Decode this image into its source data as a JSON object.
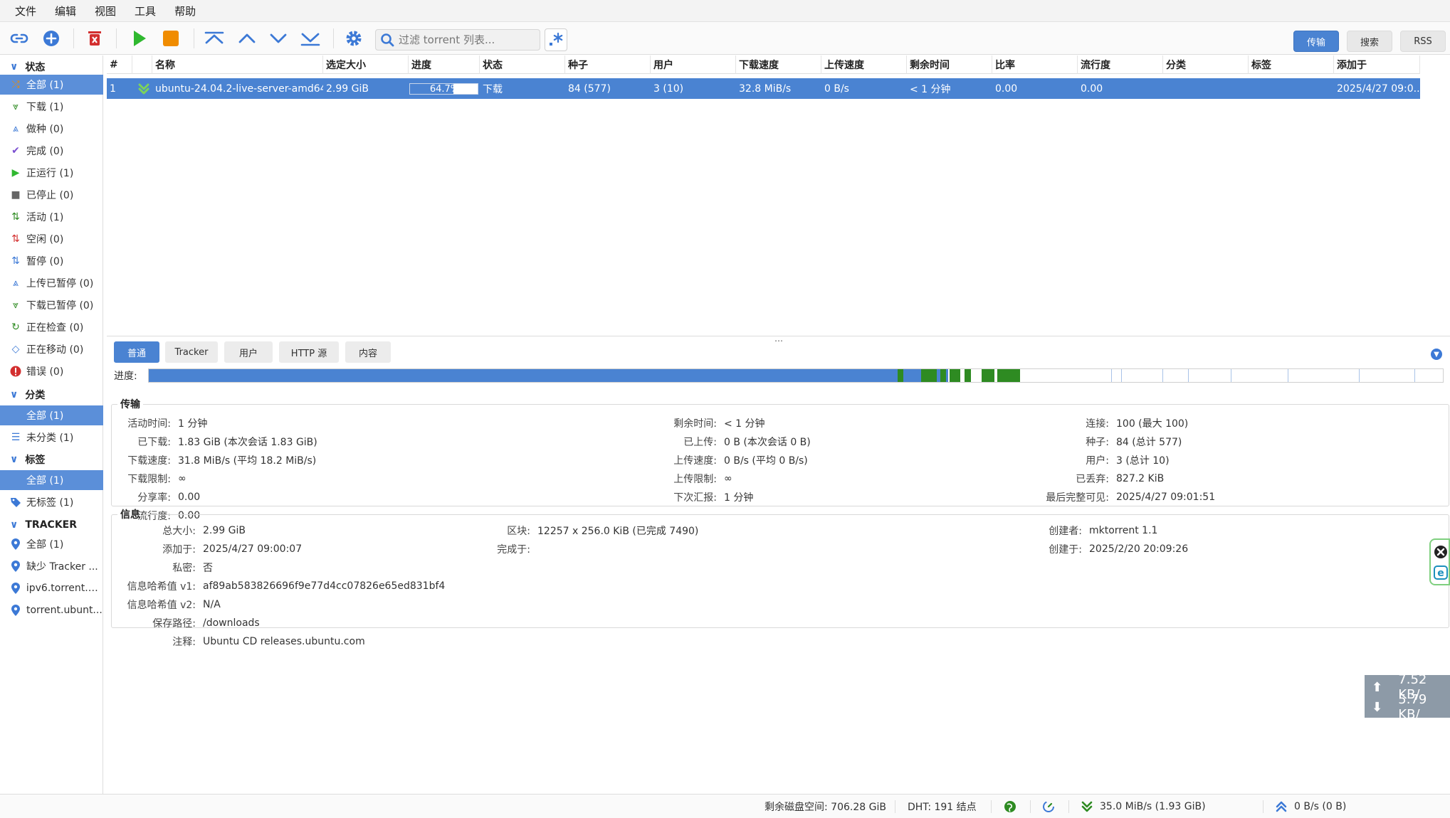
{
  "menu": [
    "文件",
    "编辑",
    "视图",
    "工具",
    "帮助"
  ],
  "toolbar": {
    "filter_placeholder": "过滤 torrent 列表...",
    "view_tabs": [
      "传输",
      "搜索",
      "RSS"
    ]
  },
  "sidebar": {
    "status_header": "状态",
    "status_items": [
      {
        "label": "全部 (1)",
        "icon": "shuffle-icon"
      },
      {
        "label": "下载 (1)",
        "icon": "download-arrows-icon"
      },
      {
        "label": "做种 (0)",
        "icon": "upload-arrows-icon"
      },
      {
        "label": "完成 (0)",
        "icon": "check-icon"
      },
      {
        "label": "正运行 (1)",
        "icon": "play-icon"
      },
      {
        "label": "已停止 (0)",
        "icon": "stop-icon"
      },
      {
        "label": "活动 (1)",
        "icon": "updown-active-icon"
      },
      {
        "label": "空闲 (0)",
        "icon": "updown-idle-icon"
      },
      {
        "label": "暂停 (0)",
        "icon": "updown-paused-icon"
      },
      {
        "label": "上传已暂停 (0)",
        "icon": "upload-paused-icon"
      },
      {
        "label": "下载已暂停 (0)",
        "icon": "download-paused-icon"
      },
      {
        "label": "正在检查 (0)",
        "icon": "refresh-icon"
      },
      {
        "label": "正在移动 (0)",
        "icon": "move-icon"
      },
      {
        "label": "错误 (0)",
        "icon": "error-icon"
      }
    ],
    "category_header": "分类",
    "category_items": [
      {
        "label": "全部 (1)",
        "icon": ""
      },
      {
        "label": "未分类 (1)",
        "icon": "list-icon"
      }
    ],
    "tag_header": "标签",
    "tag_items": [
      {
        "label": "全部 (1)",
        "icon": ""
      },
      {
        "label": "无标签 (1)",
        "icon": "tag-icon"
      }
    ],
    "tracker_header": "TRACKER",
    "tracker_items": [
      {
        "label": "全部 (1)",
        "icon": "pin-icon"
      },
      {
        "label": "缺少 Tracker ...",
        "icon": "pin-icon"
      },
      {
        "label": "ipv6.torrent.u...",
        "icon": "pin-icon"
      },
      {
        "label": "torrent.ubunt...",
        "icon": "pin-icon"
      }
    ]
  },
  "table": {
    "headers": [
      "#",
      "",
      "名称",
      "选定大小",
      "进度",
      "状态",
      "种子",
      "用户",
      "下载速度",
      "上传速度",
      "剩余时间",
      "比率",
      "流行度",
      "分类",
      "标签",
      "添加于"
    ],
    "rows": [
      {
        "num": "1",
        "name": "ubuntu-24.04.2-live-server-amd64...",
        "size": "2.99 GiB",
        "progress": 64.7,
        "progress_text": "64.7%",
        "state": "下载",
        "seeds": "84 (577)",
        "peers": "3 (10)",
        "dl_speed": "32.8 MiB/s",
        "ul_speed": "0 B/s",
        "eta": "< 1 分钟",
        "ratio": "0.00",
        "popularity": "0.00",
        "category": "",
        "tags": "",
        "added": "2025/4/27 09:0..."
      }
    ]
  },
  "props": {
    "tabs": [
      "普通",
      "Tracker",
      "用户",
      "HTTP 源",
      "内容"
    ],
    "progress_label": "进度:",
    "transfer_title": "传输",
    "transfer": {
      "col1": [
        {
          "k": "活动时间:",
          "v": "1 分钟"
        },
        {
          "k": "已下载:",
          "v": "1.83 GiB (本次会话 1.83 GiB)"
        },
        {
          "k": "下载速度:",
          "v": "31.8 MiB/s (平均 18.2 MiB/s)"
        },
        {
          "k": "下载限制:",
          "v": "∞"
        },
        {
          "k": "分享率:",
          "v": "0.00"
        },
        {
          "k": "流行度:",
          "v": "0.00"
        }
      ],
      "col2": [
        {
          "k": "剩余时间:",
          "v": "< 1 分钟"
        },
        {
          "k": "已上传:",
          "v": "0 B (本次会话 0 B)"
        },
        {
          "k": "上传速度:",
          "v": "0 B/s (平均 0 B/s)"
        },
        {
          "k": "上传限制:",
          "v": "∞"
        },
        {
          "k": "下次汇报:",
          "v": "1 分钟"
        }
      ],
      "col3": [
        {
          "k": "连接:",
          "v": "100 (最大 100)"
        },
        {
          "k": "种子:",
          "v": "84 (总计 577)"
        },
        {
          "k": "用户:",
          "v": "3 (总计 10)"
        },
        {
          "k": "已丢弃:",
          "v": "827.2 KiB"
        },
        {
          "k": "最后完整可见:",
          "v": "2025/4/27 09:01:51"
        }
      ]
    },
    "info_title": "信息",
    "info": {
      "col1": [
        {
          "k": "总大小:",
          "v": "2.99 GiB"
        },
        {
          "k": "添加于:",
          "v": "2025/4/27 09:00:07"
        },
        {
          "k": "私密:",
          "v": "否"
        },
        {
          "k": "信息哈希值 v1:",
          "v": "af89ab583826696f9e77d4cc07826e65ed831bf4"
        },
        {
          "k": "信息哈希值 v2:",
          "v": "N/A"
        },
        {
          "k": "保存路径:",
          "v": "/downloads"
        },
        {
          "k": "注释:",
          "v": "Ubuntu CD releases.ubuntu.com"
        }
      ],
      "col2": [
        {
          "k": "区块:",
          "v": "12257 x 256.0 KiB (已完成 7490)"
        },
        {
          "k": "完成于:",
          "v": ""
        }
      ],
      "col3": [
        {
          "k": "创建者:",
          "v": "mktorrent 1.1"
        },
        {
          "k": "创建于:",
          "v": "2025/2/20 20:09:26"
        }
      ]
    }
  },
  "overlay": {
    "up": "7.52 KB/",
    "down": "5.79 KB/"
  },
  "statusbar": {
    "free_space": "剩余磁盘空间: 706.28 GiB",
    "dht": "DHT: 191 结点",
    "dl": "35.0 MiB/s (1.93 GiB)",
    "ul": "0 B/s (0 B)"
  },
  "colors": {
    "accent": "#4a83d2",
    "piece_done": "#4a83d2",
    "piece_downloading": "#2e8b22"
  }
}
